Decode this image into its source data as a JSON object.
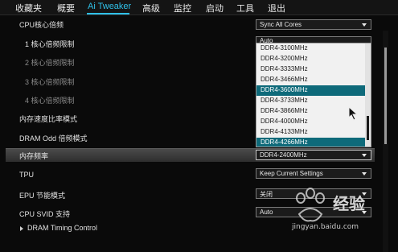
{
  "menu": {
    "items": [
      "收藏夹",
      "概要",
      "Ai Tweaker",
      "高级",
      "监控",
      "启动",
      "工具",
      "退出"
    ],
    "active": "Ai Tweaker"
  },
  "rows": {
    "cpu_core_ratio": {
      "label": "CPU核心倍频",
      "value": "Sync All Cores"
    },
    "core1": {
      "label": "1 核心倍频限制",
      "value": "Auto"
    },
    "core2": {
      "label": "2 核心倍频限制"
    },
    "core3": {
      "label": "3 核心倍频限制"
    },
    "core4": {
      "label": "4 核心倍频限制"
    },
    "mem_ratio_mode": {
      "label": "内存速度比率模式"
    },
    "dram_odd": {
      "label": "DRAM Odd 倍频模式"
    },
    "mem_freq": {
      "label": "内存频率",
      "value": "DDR4-2400MHz"
    },
    "tpu": {
      "label": "TPU",
      "value": "Keep Current Settings"
    },
    "epu": {
      "label": "EPU 节能模式",
      "value": "关闭"
    },
    "cpu_svid": {
      "label": "CPU SVID 支持",
      "value": "Auto"
    },
    "dram_timing": {
      "label": "DRAM Timing Control"
    }
  },
  "dropdown": {
    "options": [
      "DDR4-3100MHz",
      "DDR4-3200MHz",
      "DDR4-3333MHz",
      "DDR4-3466MHz",
      "DDR4-3600MHz",
      "DDR4-3733MHz",
      "DDR4-3866MHz",
      "DDR4-4000MHz",
      "DDR4-4133MHz",
      "DDR4-4266MHz"
    ],
    "highlighted": "DDR4-3600MHz",
    "current": "DDR4-4266MHz"
  },
  "watermark": {
    "text": "Baidu经验",
    "url": "jingyan.baidu.com"
  },
  "colors": {
    "accent": "#2fc0e8",
    "selection": "#0e6a7a",
    "background": "#0a0a0a"
  }
}
